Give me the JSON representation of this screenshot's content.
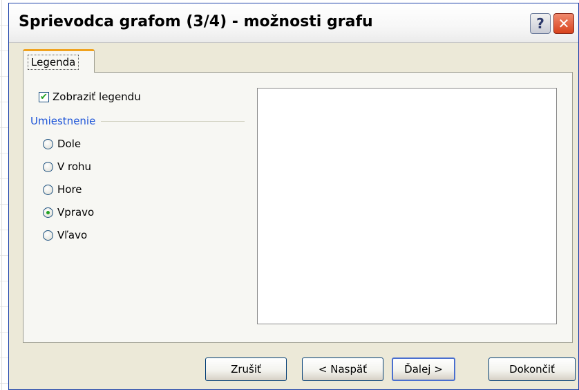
{
  "dialog": {
    "title": "Sprievodca grafom (3/4) - možnosti grafu",
    "help_label": "?",
    "close_label": "✕"
  },
  "tabs": [
    {
      "label": "Legenda",
      "selected": true
    }
  ],
  "legend": {
    "show_legend_label": "Zobraziť legendu",
    "show_legend_checked": true,
    "placement_group_label": "Umiestnenie",
    "placement_options": [
      {
        "label": "Dole",
        "selected": false
      },
      {
        "label": "V rohu",
        "selected": false
      },
      {
        "label": "Hore",
        "selected": false
      },
      {
        "label": "Vpravo",
        "selected": true
      },
      {
        "label": "Vľavo",
        "selected": false
      }
    ]
  },
  "buttons": {
    "cancel": "Zrušiť",
    "back": "< Naspäť",
    "next": "Ďalej >",
    "finish": "Dokončiť"
  },
  "icons": {
    "help": "help-icon",
    "close": "close-icon",
    "check": "checkmark-icon"
  },
  "colors": {
    "title_bar_border": "#1a3fa8",
    "group_title": "#1e55d8",
    "check_accent": "#21a121",
    "close_button": "#d8421c",
    "tab_accent": "#f0a21e"
  }
}
